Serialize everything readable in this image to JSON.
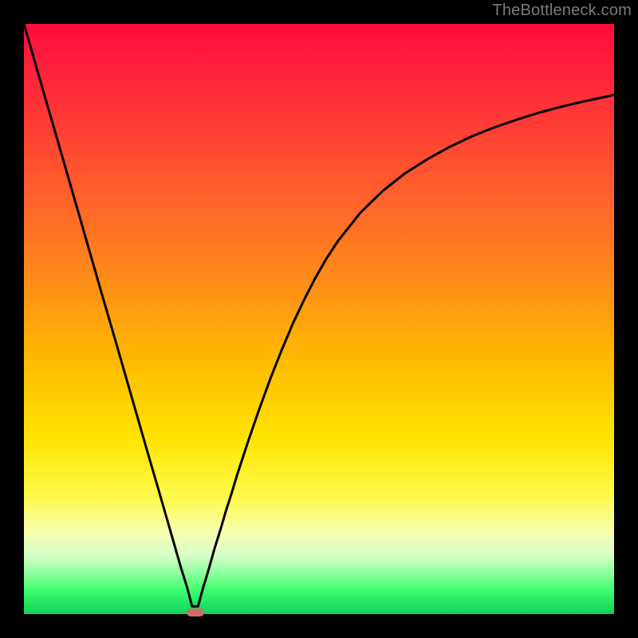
{
  "watermark": "TheBottleneck.com",
  "chart_data": {
    "type": "line",
    "title": "",
    "xlabel": "",
    "ylabel": "",
    "xlim": [
      0,
      1
    ],
    "ylim": [
      0,
      1
    ],
    "grid": false,
    "legend": false,
    "annotations": [],
    "background_gradient": {
      "direction": "vertical",
      "stops": [
        {
          "pos": 0.0,
          "color": "#ff0a3a"
        },
        {
          "pos": 0.06,
          "color": "#ff1d3c"
        },
        {
          "pos": 0.18,
          "color": "#ff3f35"
        },
        {
          "pos": 0.32,
          "color": "#ff6a28"
        },
        {
          "pos": 0.46,
          "color": "#ff9414"
        },
        {
          "pos": 0.58,
          "color": "#ffbd00"
        },
        {
          "pos": 0.7,
          "color": "#ffe400"
        },
        {
          "pos": 0.8,
          "color": "#fff94a"
        },
        {
          "pos": 0.86,
          "color": "#f8ffb0"
        },
        {
          "pos": 0.9,
          "color": "#d7ffc8"
        },
        {
          "pos": 0.93,
          "color": "#8fff9e"
        },
        {
          "pos": 0.96,
          "color": "#3dfc6d"
        },
        {
          "pos": 1.0,
          "color": "#0ed15a"
        }
      ]
    },
    "series": [
      {
        "name": "curve",
        "color": "#000000",
        "stroke_width": 3,
        "x": [
          0.0,
          0.019,
          0.038,
          0.057,
          0.076,
          0.095,
          0.114,
          0.133,
          0.152,
          0.171,
          0.19,
          0.209,
          0.228,
          0.247,
          0.266,
          0.276,
          0.285,
          0.295,
          0.304,
          0.309,
          0.314,
          0.323,
          0.333,
          0.342,
          0.352,
          0.361,
          0.38,
          0.399,
          0.418,
          0.437,
          0.456,
          0.475,
          0.494,
          0.513,
          0.532,
          0.57,
          0.608,
          0.646,
          0.684,
          0.722,
          0.76,
          0.798,
          0.836,
          0.874,
          0.912,
          0.95,
          0.988,
          1.0
        ],
        "y": [
          1.0,
          0.934,
          0.868,
          0.803,
          0.737,
          0.671,
          0.605,
          0.539,
          0.474,
          0.408,
          0.342,
          0.276,
          0.211,
          0.145,
          0.079,
          0.047,
          0.013,
          0.013,
          0.046,
          0.062,
          0.079,
          0.111,
          0.143,
          0.174,
          0.205,
          0.235,
          0.293,
          0.348,
          0.4,
          0.448,
          0.493,
          0.533,
          0.57,
          0.603,
          0.632,
          0.68,
          0.717,
          0.747,
          0.771,
          0.792,
          0.81,
          0.825,
          0.838,
          0.85,
          0.86,
          0.869,
          0.877,
          0.88
        ]
      }
    ],
    "min_marker": {
      "x": 0.29,
      "y": 0.003,
      "color": "#cd6e66"
    }
  }
}
